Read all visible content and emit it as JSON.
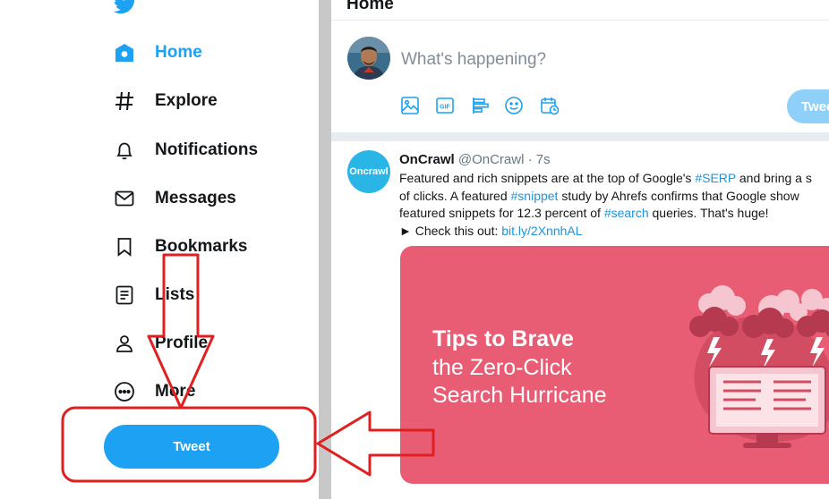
{
  "sidebar": {
    "items": [
      {
        "label": "Home",
        "icon": "home-icon"
      },
      {
        "label": "Explore",
        "icon": "hashtag-icon"
      },
      {
        "label": "Notifications",
        "icon": "bell-icon"
      },
      {
        "label": "Messages",
        "icon": "envelope-icon"
      },
      {
        "label": "Bookmarks",
        "icon": "bookmark-icon"
      },
      {
        "label": "Lists",
        "icon": "list-icon"
      },
      {
        "label": "Profile",
        "icon": "person-icon"
      },
      {
        "label": "More",
        "icon": "more-icon"
      }
    ],
    "tweet_label": "Tweet"
  },
  "main": {
    "title": "Home",
    "compose": {
      "placeholder": "What's happening?",
      "tweet_label": "Tweet",
      "tools": [
        "image-icon",
        "gif-icon",
        "poll-icon",
        "emoji-icon",
        "schedule-icon"
      ]
    },
    "tweet": {
      "avatar_text": "Oncrawl",
      "name": "OnCrawl",
      "meta": "@OnCrawl · 7s",
      "line1_a": "Featured and rich snippets are at the top of Google's ",
      "line1_tag": "#SERP",
      "line1_b": " and bring a s",
      "line2_a": "of clicks. A featured ",
      "line2_tag": "#snippet",
      "line2_b": " study by Ahrefs confirms that Google show",
      "line3_a": "featured snippets for 12.3 percent of ",
      "line3_tag": "#search",
      "line3_b": " queries. That's huge!",
      "line4_a": "► Check this out: ",
      "line4_link": "bit.ly/2XnnhAL",
      "card": {
        "line1": "Tips to Brave",
        "line2": "the Zero-Click",
        "line3": "Search Hurricane"
      }
    }
  },
  "colors": {
    "accent": "#1da1f2",
    "card": "#e85c74",
    "annotation": "#e02020"
  }
}
